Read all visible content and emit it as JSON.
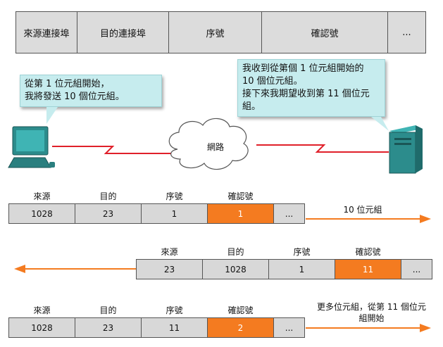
{
  "header": {
    "fields": [
      "來源連接埠",
      "目的連接埠",
      "序號",
      "確認號",
      "..."
    ]
  },
  "callout_left": "從第 1 位元組開始，\n我將發送 10 個位元組。",
  "callout_right": "我收到從第個 1 位元組開始的\n10 個位元組。\n接下來我期望收到第 11 個位元\n組。",
  "network_label": "網路",
  "rows": [
    {
      "labels": [
        "來源",
        "目的",
        "序號",
        "確認號"
      ],
      "values": [
        "1028",
        "23",
        "1",
        "1",
        "..."
      ],
      "note": "10 位元組"
    },
    {
      "labels": [
        "來源",
        "目的",
        "序號",
        "確認號"
      ],
      "values": [
        "23",
        "1028",
        "1",
        "11",
        "..."
      ]
    },
    {
      "labels": [
        "來源",
        "目的",
        "序號",
        "確認號"
      ],
      "values": [
        "1028",
        "23",
        "11",
        "2",
        "..."
      ],
      "note": "更多位元組，從第 11 個位元\n組開始"
    }
  ],
  "colors": {
    "accent": "#f47b20",
    "callout": "#c6ecee",
    "cell": "#d8d8d8",
    "line": "#e0202a"
  }
}
